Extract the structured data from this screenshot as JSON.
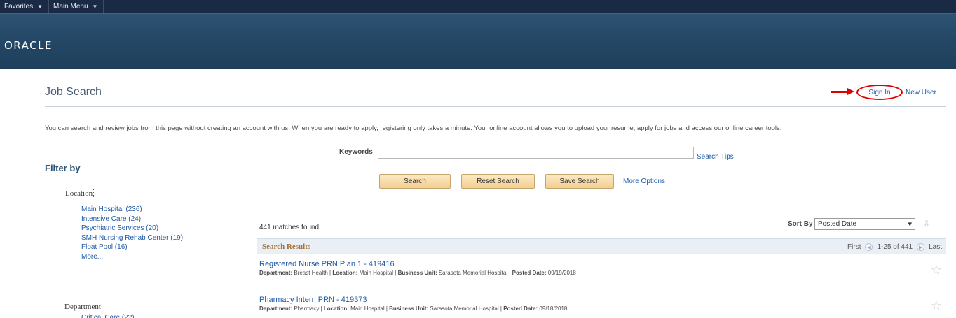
{
  "topnav": {
    "favorites": "Favorites",
    "main_menu": "Main Menu"
  },
  "header": {
    "logo": "ORACLE"
  },
  "page": {
    "title": "Job Search",
    "sign_in": "Sign In",
    "new_user": "New User",
    "intro": "You can search and review jobs from this page without creating an account with us. When you are ready to apply, registering only takes a minute. Your online account allows you to upload your resume, apply for jobs and access our online career tools."
  },
  "search": {
    "keywords_label": "Keywords",
    "keywords_value": "",
    "search_tips": "Search Tips",
    "search_btn": "Search",
    "reset_btn": "Reset Search",
    "save_btn": "Save Search",
    "more_options": "More Options"
  },
  "filter": {
    "title": "Filter by",
    "location_label": "Location",
    "location_items": [
      "Main Hospital (236)",
      "Intensive Care (24)",
      "Psychiatric Services (20)",
      "SMH Nursing Rehab Center (19)",
      "Float Pool (16)",
      "More..."
    ],
    "department_label": "Department",
    "department_first": "Critical Care (??)"
  },
  "results": {
    "matches": "441 matches found",
    "sort_label": "Sort By",
    "sort_value": "Posted Date",
    "section_title": "Search Results",
    "pager_first": "First",
    "pager_range": "1-25 of 441",
    "pager_last": "Last",
    "jobs": [
      {
        "title": "Registered Nurse PRN Plan 1 - 419416",
        "department_label": "Department:",
        "department": "Breast Health",
        "location_label": "Location:",
        "location": "Main Hospital",
        "business_unit_label": "Business Unit:",
        "business_unit": "Sarasota Memorial Hospital",
        "posted_label": "Posted Date:",
        "posted": "09/19/2018"
      },
      {
        "title": "Pharmacy Intern PRN - 419373",
        "department_label": "Department:",
        "department": "Pharmacy",
        "location_label": "Location:",
        "location": "Main Hospital",
        "business_unit_label": "Business Unit:",
        "business_unit": "Sarasota Memorial Hospital",
        "posted_label": "Posted Date:",
        "posted": "09/18/2018"
      }
    ]
  },
  "colors": {
    "nav_bg": "#1a2a44",
    "header_bg": "#244866",
    "link": "#1f5aa6",
    "button_bg": "#f3cf90",
    "annotation_red": "#e00000",
    "results_title": "#a5753b"
  },
  "icons": {
    "nav_caret": "caret-down-icon",
    "favorite": "star-outline-icon",
    "annotation_arrow": "red-arrow-icon",
    "sort_direction": "sort-down-arrow-icon",
    "pager_prev": "chevron-left-icon",
    "pager_next": "chevron-right-icon"
  }
}
